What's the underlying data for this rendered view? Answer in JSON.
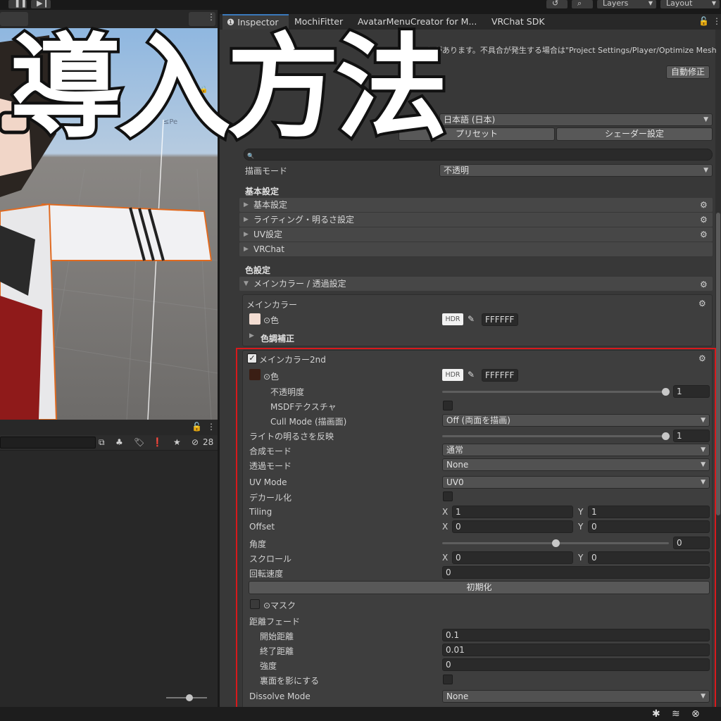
{
  "overlay_title": "導入方法",
  "toolbar": {
    "layers_label": "Layers",
    "layout_label": "Layout"
  },
  "hierarchy": {
    "hidden_count": "28"
  },
  "tabs": [
    {
      "label": "Inspector",
      "active": true
    },
    {
      "label": "MochiFitter",
      "active": false
    },
    {
      "label": "AvatarMenuCreator for M...",
      "active": false
    },
    {
      "label": "VRChat SDK",
      "active": false
    }
  ],
  "inspector": {
    "warning_text": "とがあります。不具合が発生する場合は\"Project Settings/Player/Optimize Mesh",
    "auto_fix_button": "自動修正",
    "language_value": "日本語 (日本)",
    "preset_button": "プリセット",
    "shader_settings_button": "シェーダー設定",
    "render_mode_label": "描画モード",
    "render_mode_value": "不透明",
    "basic_section": "基本設定",
    "foldouts": [
      "基本設定",
      "ライティング・明るさ設定",
      "UV設定",
      "VRChat"
    ],
    "color_section": "色設定",
    "main_color_foldout": "メインカラー / 透過設定",
    "main_color": {
      "title": "メインカラー",
      "color_label": "⊙色",
      "hdr": "HDR",
      "hex": "FFFFFF",
      "tone_correction": "色調補正"
    },
    "main_color_2nd": {
      "title": "メインカラー2nd",
      "enabled": true,
      "color_label": "⊙色",
      "hdr": "HDR",
      "hex": "FFFFFF",
      "opacity_label": "不透明度",
      "opacity_value": "1",
      "msdf_label": "MSDFテクスチャ",
      "cull_label": "Cull Mode (描画面)",
      "cull_value": "Off (両面を描画)",
      "light_label": "ライトの明るさを反映",
      "light_value": "1",
      "blend_label": "合成モード",
      "blend_value": "通常",
      "alpha_label": "透過モード",
      "alpha_value": "None",
      "uv_mode_label": "UV Mode",
      "uv_mode_value": "UV0",
      "decal_label": "デカール化",
      "tiling_label": "Tiling",
      "tiling_x": "1",
      "tiling_y": "1",
      "offset_label": "Offset",
      "offset_x": "0",
      "offset_y": "0",
      "angle_label": "角度",
      "angle_value": "0",
      "scroll_label": "スクロール",
      "scroll_x": "0",
      "scroll_y": "0",
      "rotation_label": "回転速度",
      "rotation_value": "0",
      "reset_button": "初期化",
      "mask_label": "⊙マスク",
      "distance_fade_label": "距離フェード",
      "fade_start_label": "開始距離",
      "fade_start_value": "0.1",
      "fade_end_label": "終了距離",
      "fade_end_value": "0.01",
      "strength_label": "強度",
      "strength_value": "0",
      "backface_label": "裏面を影にする",
      "dissolve_label": "Dissolve Mode",
      "dissolve_value": "None",
      "axis_x": "X",
      "axis_y": "Y"
    }
  },
  "colors": {
    "highlight": "#d8191c",
    "accent": "#3a79bb"
  }
}
